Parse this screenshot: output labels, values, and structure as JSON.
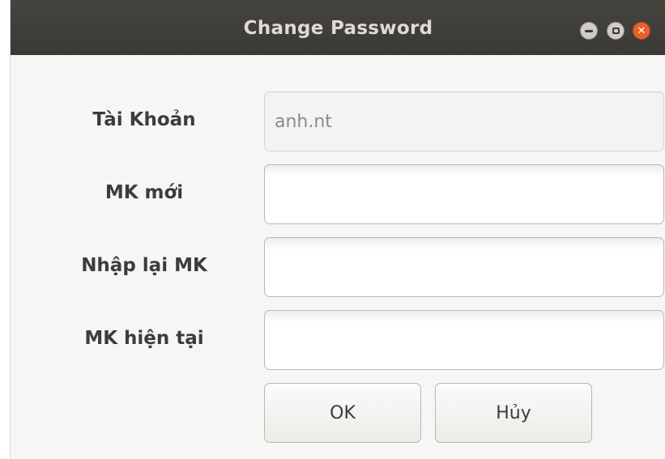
{
  "window": {
    "title": "Change Password"
  },
  "form": {
    "account": {
      "label": "Tài Khoản",
      "value": "anh.nt"
    },
    "new_password": {
      "label": "MK mới",
      "value": ""
    },
    "confirm_password": {
      "label": "Nhập lại MK",
      "value": ""
    },
    "current_password": {
      "label": "MK hiện tại",
      "value": ""
    }
  },
  "buttons": {
    "ok": "OK",
    "cancel": "Hủy"
  },
  "colors": {
    "titlebar": "#3c3b37",
    "close_button": "#e9602e",
    "window_bg": "#f6f6f5"
  },
  "icons": {
    "minimize": "minimize-icon",
    "maximize": "maximize-icon",
    "close": "close-icon"
  }
}
